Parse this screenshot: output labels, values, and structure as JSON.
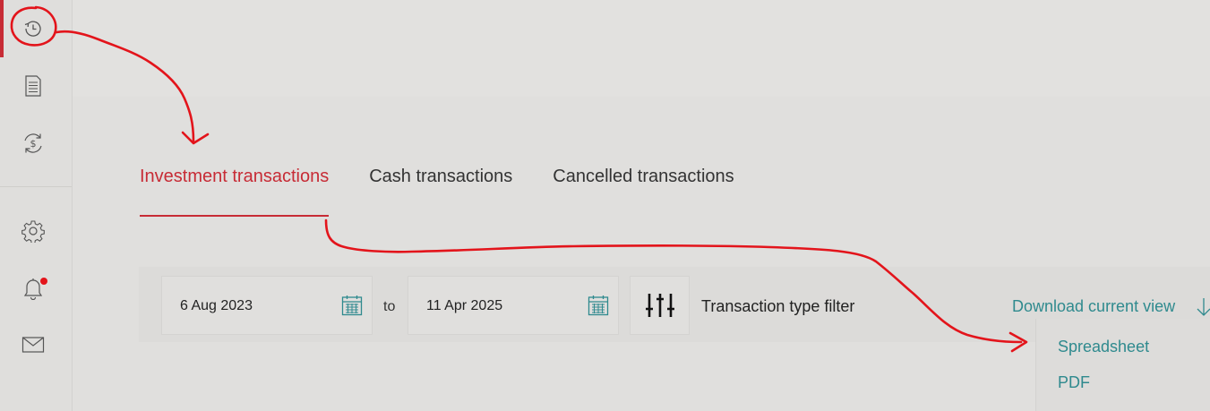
{
  "colors": {
    "accent_red": "#c72b35",
    "link_teal": "#2f8a8e",
    "annotation_red": "#e3141b"
  },
  "sidebar": {
    "items": [
      {
        "icon": "history-icon",
        "active": true
      },
      {
        "icon": "document-icon"
      },
      {
        "icon": "cash-exchange-icon"
      },
      {
        "icon": "gear-icon"
      },
      {
        "icon": "bell-icon",
        "badge": true
      },
      {
        "icon": "mail-icon"
      }
    ]
  },
  "tabs": [
    {
      "label": "Investment transactions",
      "active": true
    },
    {
      "label": "Cash transactions"
    },
    {
      "label": "Cancelled transactions"
    }
  ],
  "filters": {
    "from_date": "6 Aug 2023",
    "to_label": "to",
    "to_date": "11 Apr 2025",
    "transaction_type_label": "Transaction type filter"
  },
  "download": {
    "label": "Download current view",
    "options": [
      "Spreadsheet",
      "PDF"
    ]
  }
}
